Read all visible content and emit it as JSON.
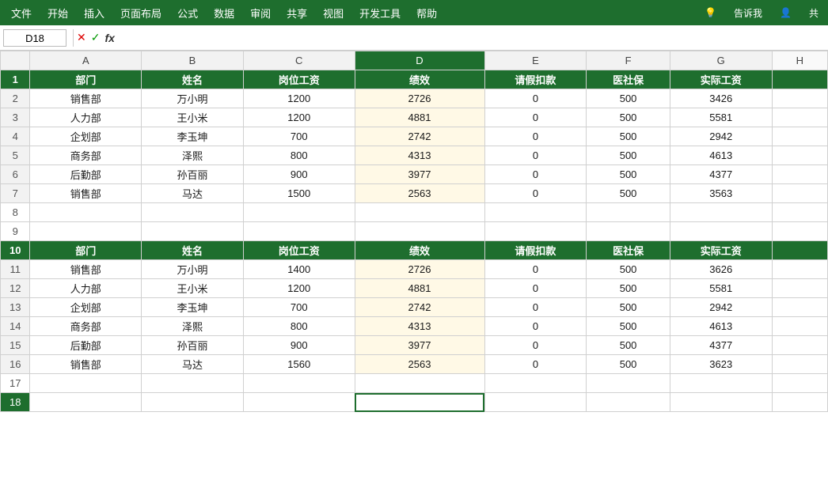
{
  "menu": {
    "items": [
      "文件",
      "开始",
      "插入",
      "页面布局",
      "公式",
      "数据",
      "审阅",
      "共享",
      "视图",
      "开发工具",
      "帮助"
    ],
    "right_items": [
      "告诉我",
      "共"
    ]
  },
  "formula_bar": {
    "cell_ref": "D18",
    "icons": [
      "✕",
      "✓",
      "fx"
    ]
  },
  "columns": {
    "headers": [
      "A",
      "B",
      "C",
      "D",
      "E",
      "F",
      "G",
      "H"
    ],
    "labels": [
      "部门",
      "姓名",
      "岗位工资",
      "绩效",
      "请假扣款",
      "医社保",
      "实际工资"
    ]
  },
  "table1": {
    "header_row": 1,
    "data": [
      [
        "销售部",
        "万小明",
        "1200",
        "2726",
        "0",
        "500",
        "3426"
      ],
      [
        "人力部",
        "王小米",
        "1200",
        "4881",
        "0",
        "500",
        "5581"
      ],
      [
        "企划部",
        "李玉坤",
        "700",
        "2742",
        "0",
        "500",
        "2942"
      ],
      [
        "商务部",
        "泽熙",
        "800",
        "4313",
        "0",
        "500",
        "4613"
      ],
      [
        "后勤部",
        "孙百丽",
        "900",
        "3977",
        "0",
        "500",
        "4377"
      ],
      [
        "销售部",
        "马达",
        "1500",
        "2563",
        "0",
        "500",
        "3563"
      ]
    ]
  },
  "table2": {
    "header_row": 10,
    "data": [
      [
        "销售部",
        "万小明",
        "1400",
        "2726",
        "0",
        "500",
        "3626"
      ],
      [
        "人力部",
        "王小米",
        "1200",
        "4881",
        "0",
        "500",
        "5581"
      ],
      [
        "企划部",
        "李玉坤",
        "700",
        "2742",
        "0",
        "500",
        "2942"
      ],
      [
        "商务部",
        "泽熙",
        "800",
        "4313",
        "0",
        "500",
        "4613"
      ],
      [
        "后勤部",
        "孙百丽",
        "900",
        "3977",
        "0",
        "500",
        "4377"
      ],
      [
        "销售部",
        "马达",
        "1560",
        "2563",
        "0",
        "500",
        "3623"
      ]
    ]
  },
  "colors": {
    "header_bg": "#1e6e2e",
    "header_text": "#ffffff",
    "menu_bg": "#1e6e2e",
    "selected_col_header": "#1e6e2e"
  }
}
